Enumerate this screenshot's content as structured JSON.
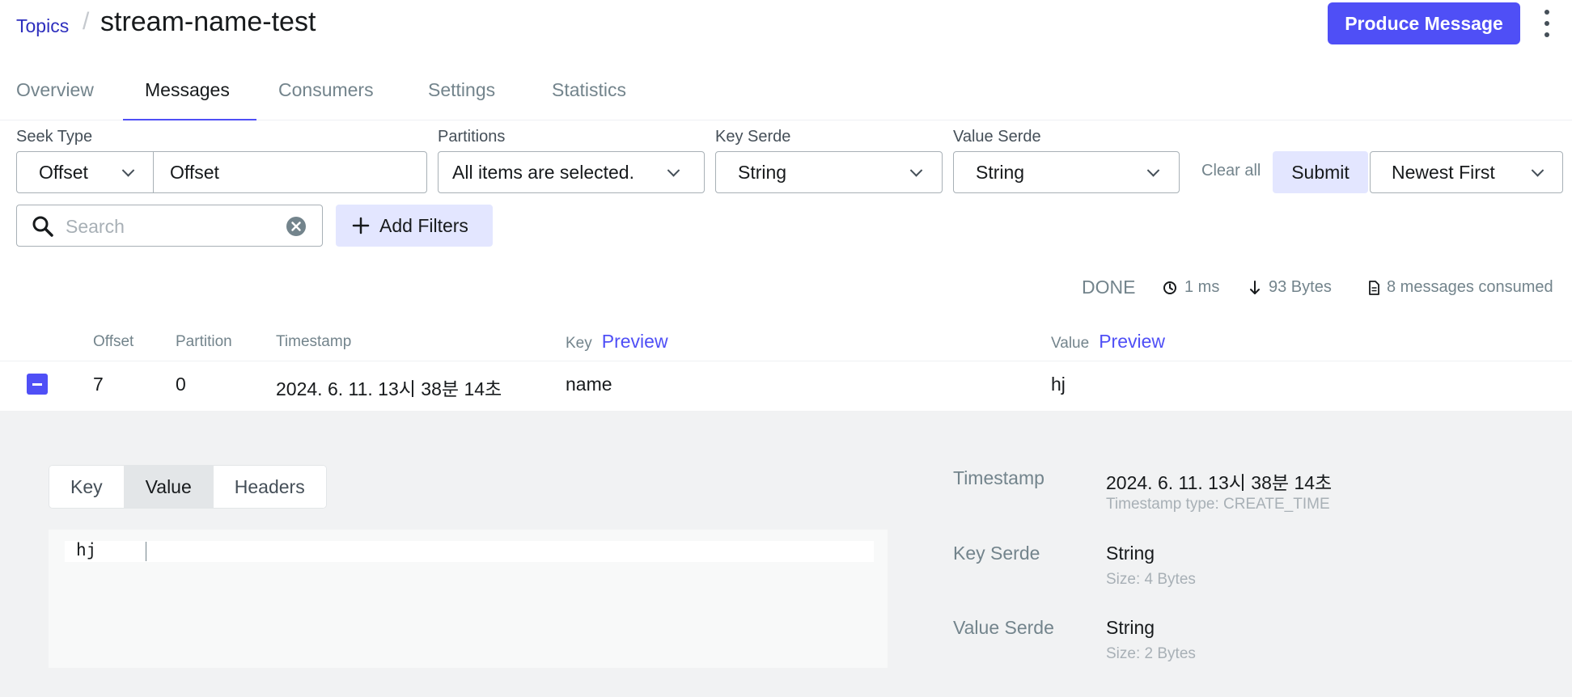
{
  "header": {
    "breadcrumb_link": "Topics",
    "breadcrumb_sep": "/",
    "title": "stream-name-test",
    "produce_label": "Produce Message"
  },
  "tabs": [
    {
      "label": "Overview",
      "active": false
    },
    {
      "label": "Messages",
      "active": true
    },
    {
      "label": "Consumers",
      "active": false
    },
    {
      "label": "Settings",
      "active": false
    },
    {
      "label": "Statistics",
      "active": false
    }
  ],
  "filters": {
    "seek_type": {
      "label": "Seek Type",
      "value": "Offset",
      "input_value": "Offset"
    },
    "partitions": {
      "label": "Partitions",
      "value": "All items are selected."
    },
    "key_serde": {
      "label": "Key Serde",
      "value": "String"
    },
    "value_serde": {
      "label": "Value Serde",
      "value": "String"
    },
    "clear_all": "Clear all",
    "submit": "Submit",
    "sort": "Newest First"
  },
  "search": {
    "placeholder": "Search",
    "value": ""
  },
  "add_filters": "Add Filters",
  "status": {
    "state": "DONE",
    "elapsed": "1 ms",
    "bytes": "93 Bytes",
    "consumed": "8 messages consumed"
  },
  "table": {
    "headers": {
      "offset": "Offset",
      "partition": "Partition",
      "timestamp": "Timestamp",
      "key": "Key",
      "value": "Value",
      "preview": "Preview"
    },
    "rows": [
      {
        "offset": "7",
        "partition": "0",
        "timestamp": "2024. 6. 11. 13시 38분 14초",
        "key": "name",
        "value": "hj"
      }
    ]
  },
  "detail": {
    "tabs": [
      {
        "label": "Key",
        "active": false
      },
      {
        "label": "Value",
        "active": true
      },
      {
        "label": "Headers",
        "active": false
      }
    ],
    "content": "hj",
    "timestamp_label": "Timestamp",
    "timestamp_value": "2024. 6. 11. 13시 38분 14초",
    "timestamp_type": "Timestamp type: CREATE_TIME",
    "key_serde_label": "Key Serde",
    "key_serde_value": "String",
    "key_size": "Size: 4 Bytes",
    "value_serde_label": "Value Serde",
    "value_serde_value": "String",
    "value_size": "Size: 2 Bytes"
  },
  "colors": {
    "accent": "#4f4ff6",
    "accent_light": "#e3e6ff",
    "link": "#2e2fbe",
    "muted": "#73848c"
  }
}
